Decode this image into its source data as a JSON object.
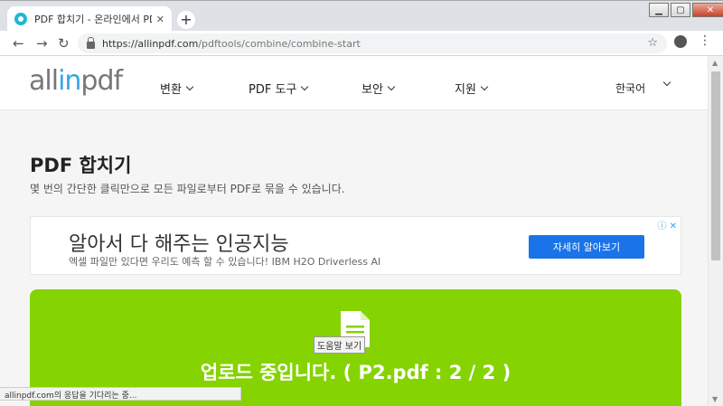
{
  "browser": {
    "tab_title": "PDF 합치기 - 온라인에서 PDF 파",
    "tab_close": "✕",
    "newtab": "+",
    "url_host": "https://allinpdf.com",
    "url_path": "/pdftools/combine/combine-start",
    "status_text": "allinpdf.com의 응답을 기다리는 중..."
  },
  "site": {
    "logo_part1": "all",
    "logo_part2": "in",
    "logo_part3": "pdf",
    "nav": [
      "변환",
      "PDF 도구",
      "보안",
      "지원"
    ],
    "language": "한국어",
    "accent_color": "#35a7e8"
  },
  "page": {
    "title": "PDF 합치기",
    "subtitle": "몇 번의 간단한 클릭만으로 모든 파일로부터 PDF로 묶을 수 있습니다."
  },
  "ad": {
    "title": "알아서 다 해주는 인공지능",
    "description": "엑셀 파일만 있다면 우리도 예측 할 수 있습니다! IBM H2O Driverless AI",
    "button": "자세히 알아보기",
    "badges": "ⓘ ✕"
  },
  "upload": {
    "tooltip": "도움말 보기",
    "message": "업로드 중입니다. ( P2.pdf : 2 / 2 )",
    "bg_color": "#85d300"
  }
}
